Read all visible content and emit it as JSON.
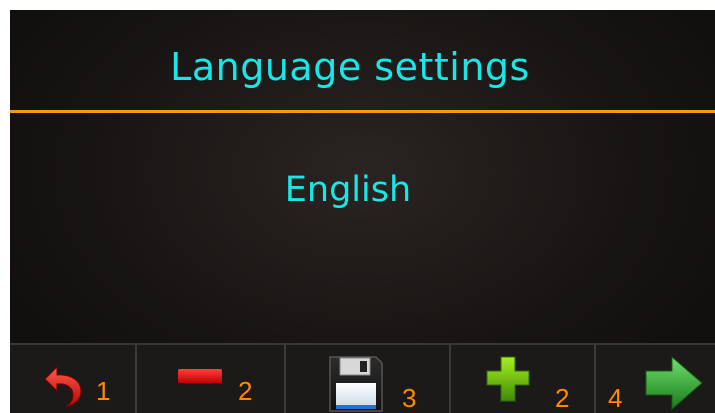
{
  "header": {
    "title": "Language settings"
  },
  "main": {
    "current_language": "English"
  },
  "toolbar": {
    "back": {
      "icon": "undo-arrow-icon",
      "key": "1",
      "color": "#e01818"
    },
    "minus": {
      "icon": "minus-icon",
      "key": "2",
      "color": "#e81010"
    },
    "save": {
      "icon": "floppy-disk-icon",
      "key": "3"
    },
    "plus": {
      "icon": "plus-icon",
      "key": "2",
      "color": "#6bd00c"
    },
    "next": {
      "icon": "right-arrow-icon",
      "key": "4",
      "color": "#2ea52e"
    }
  },
  "colors": {
    "text": "#19e6e6",
    "accent_line": "#f29a12",
    "key_number": "#ff8a00"
  }
}
